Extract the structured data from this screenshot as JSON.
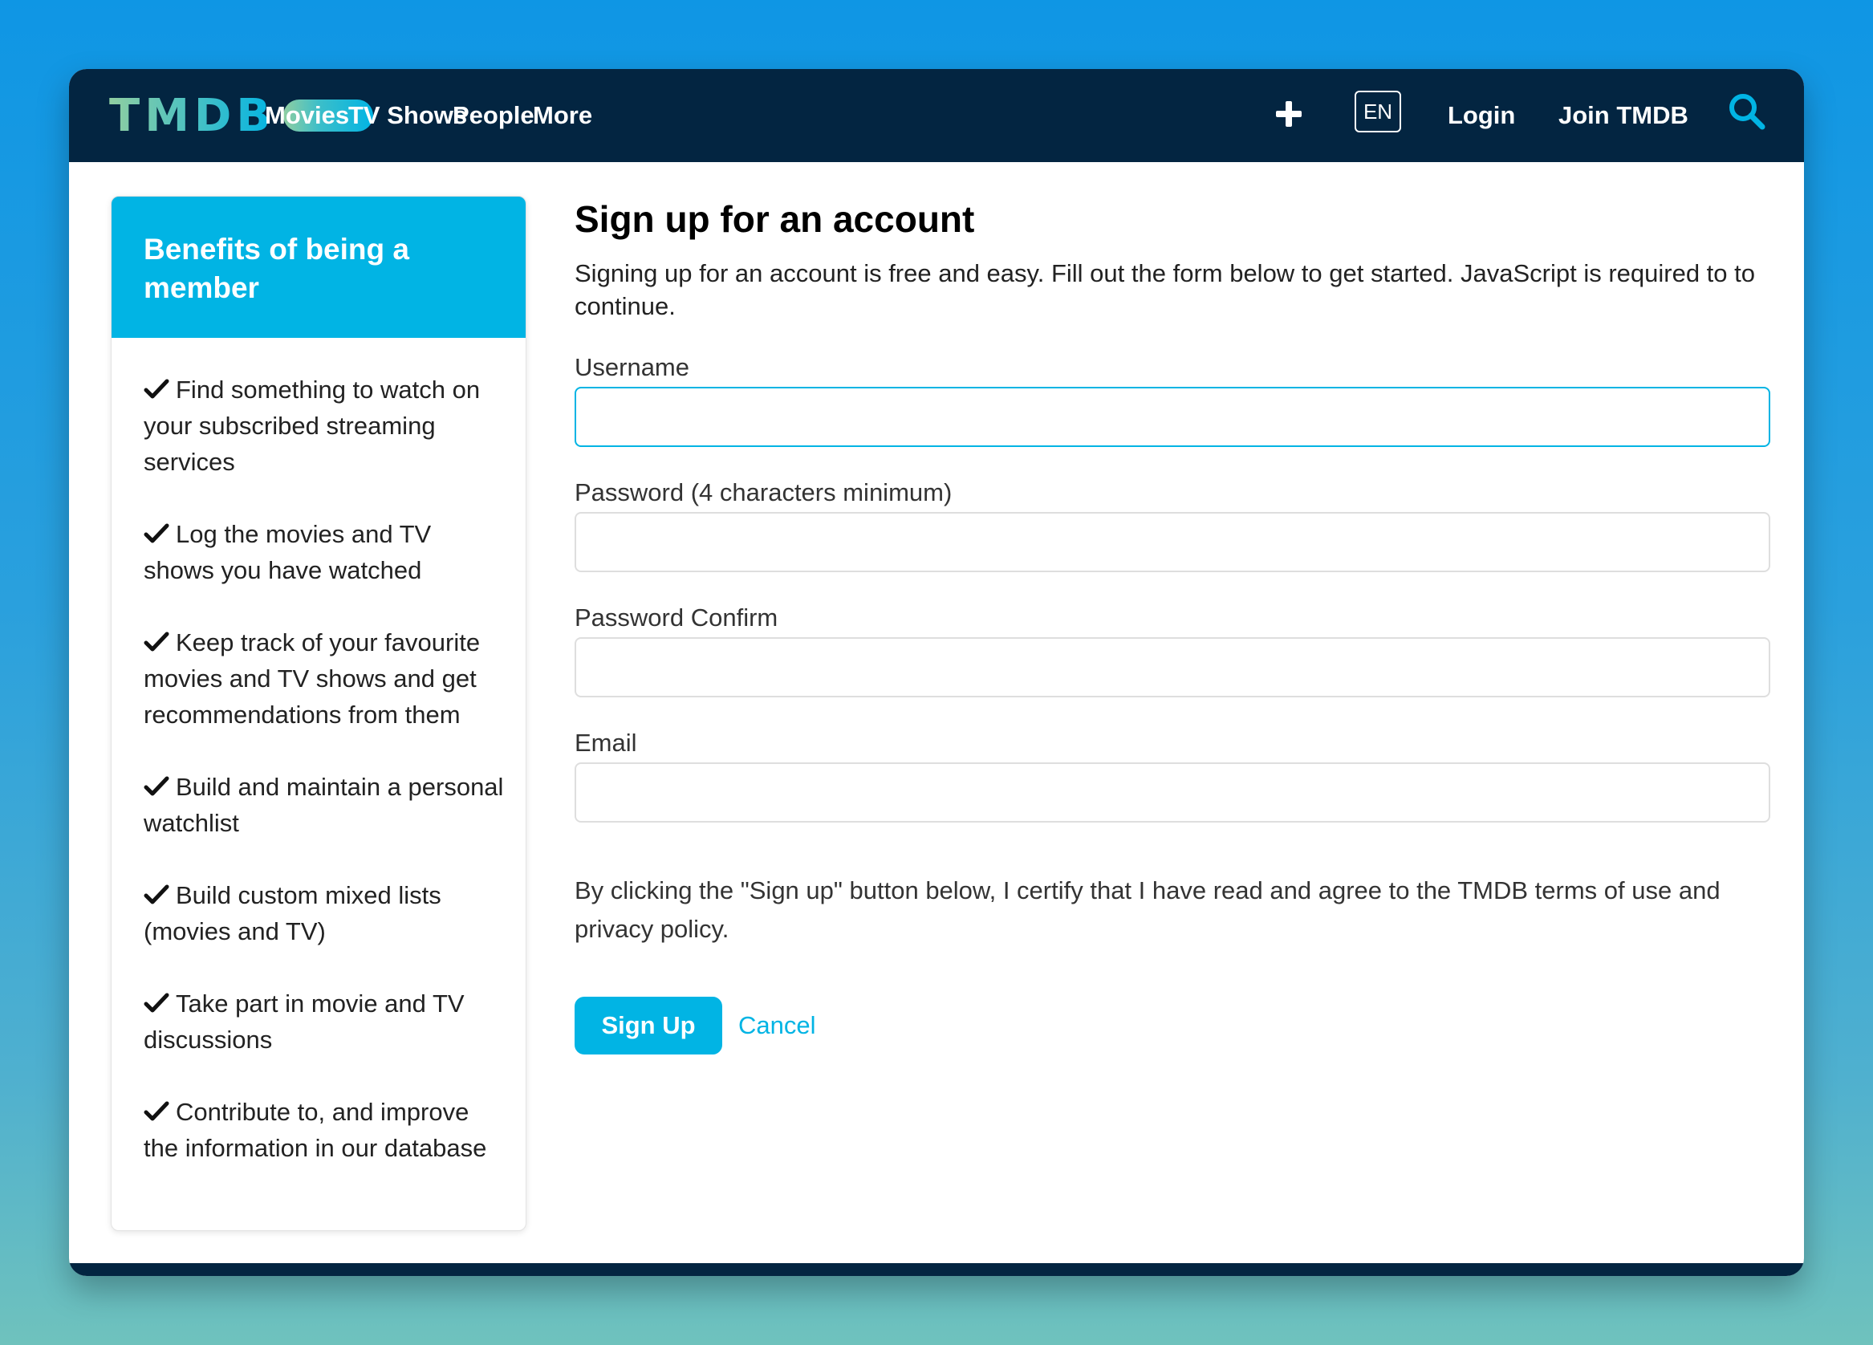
{
  "nav": {
    "logo_text": "TMDB",
    "links": [
      "Movies",
      "TV Shows",
      "People",
      "More"
    ],
    "language": "EN",
    "login": "Login",
    "join": "Join TMDB",
    "icons": {
      "add": "plus-icon",
      "search": "search-icon"
    }
  },
  "sidebar": {
    "title": "Benefits of being a member",
    "benefits": [
      "Find something to watch on your subscribed streaming services",
      "Log the movies and TV shows you have watched",
      "Keep track of your favourite movies and TV shows and get recommendations from them",
      "Build and maintain a personal watchlist",
      "Build custom mixed lists (movies and TV)",
      "Take part in movie and TV discussions",
      "Contribute to, and improve the information in our database"
    ]
  },
  "form": {
    "title": "Sign up for an account",
    "intro": "Signing up for an account is free and easy. Fill out the form below to get started. JavaScript is required to to continue.",
    "fields": [
      {
        "label": "Username",
        "value": ""
      },
      {
        "label": "Password (4 characters minimum)",
        "value": ""
      },
      {
        "label": "Password Confirm",
        "value": ""
      },
      {
        "label": "Email",
        "value": ""
      }
    ],
    "terms": "By clicking the \"Sign up\" button below, I certify that I have read and agree to the TMDB terms of use and privacy policy.",
    "submit_label": "Sign Up",
    "cancel_label": "Cancel"
  },
  "colors": {
    "navy": "#032541",
    "accent": "#01b4e4",
    "logo_green": "#90cea1"
  }
}
